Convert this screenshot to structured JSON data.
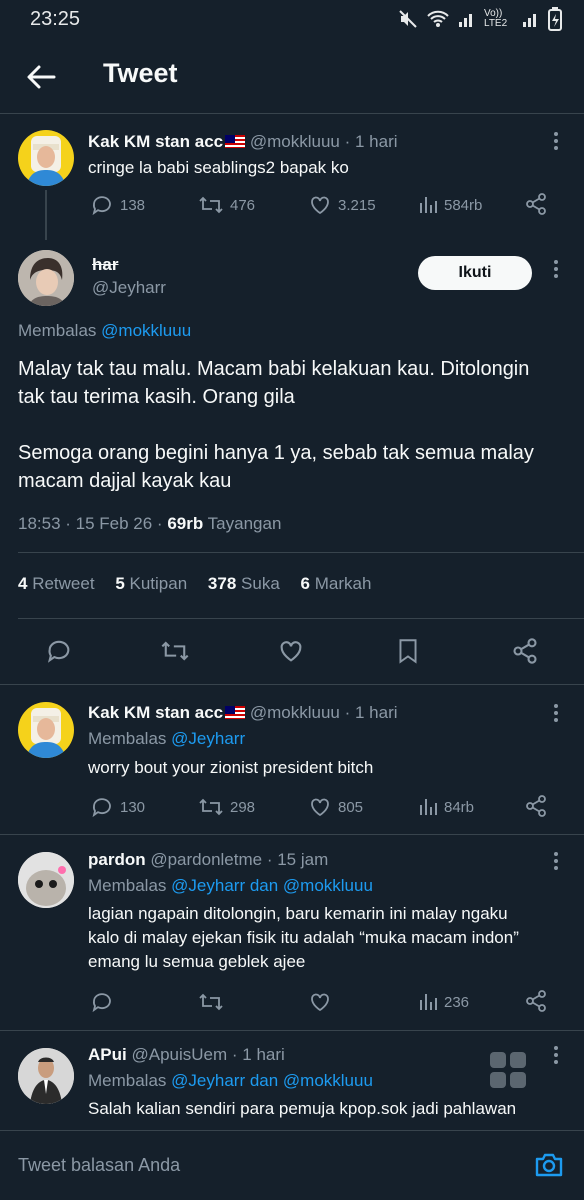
{
  "status": {
    "time": "23:25",
    "network": "Vo)) LTE2"
  },
  "header": {
    "title": "Tweet"
  },
  "parent": {
    "name": "Kak KM stan acc",
    "handle": "@mokkluuu",
    "time": "· 1 hari",
    "text": "cringe la babi seablings2 bapak ko",
    "replies": "138",
    "retweets": "476",
    "likes": "3.215",
    "views": "584rb"
  },
  "main": {
    "name": "har",
    "handle": "@Jeyharr",
    "follow_label": "Ikuti",
    "replying_prefix": "Membalas",
    "replying_to": "@mokkluuu",
    "text": "Malay tak tau malu. Macam babi kelakuan kau. Ditolongin tak tau terima kasih. Orang gila\n\nSemoga orang begini hanya 1 ya, sebab tak semua malay macam dajjal kayak kau",
    "timestamp": "18:53 · 15 Feb 26 · ",
    "views_count": "69rb",
    "views_label": " Tayangan",
    "stats": {
      "retweets_n": "4",
      "retweets_l": "Retweet",
      "quotes_n": "5",
      "quotes_l": "Kutipan",
      "likes_n": "378",
      "likes_l": "Suka",
      "bookmarks_n": "6",
      "bookmarks_l": "Markah"
    }
  },
  "replies": [
    {
      "name": "Kak KM stan acc",
      "handle": "@mokkluuu",
      "time": "· 1 hari",
      "replying_prefix": "Membalas",
      "replying_to": "@Jeyharr",
      "text": "worry bout your zionist president bitch",
      "replies": "130",
      "retweets": "298",
      "likes": "805",
      "views": "84rb"
    },
    {
      "name": "pardon",
      "handle": "@pardonletme",
      "time": "· 15 jam",
      "replying_prefix": "Membalas",
      "replying_to": "@Jeyharr dan @mokkluuu",
      "text": "lagian ngapain ditolongin, baru kemarin ini malay ngaku\nkalo di malay ejekan fisik itu adalah “muka macam indon”\nemang lu semua geblek ajee",
      "views": "236"
    },
    {
      "name": "APui",
      "handle": "@ApuisUem",
      "time": "· 1 hari",
      "replying_prefix": "Membalas",
      "replying_to": "@Jeyharr dan @mokkluuu",
      "text": "Salah kalian sendiri para pemuja kpop.sok jadi pahlawan"
    }
  ],
  "reply_bar": {
    "placeholder": "Tweet balasan Anda"
  },
  "colors": {
    "background": "#15202b",
    "accent": "#1d9bf0",
    "muted": "#8b98a5"
  }
}
